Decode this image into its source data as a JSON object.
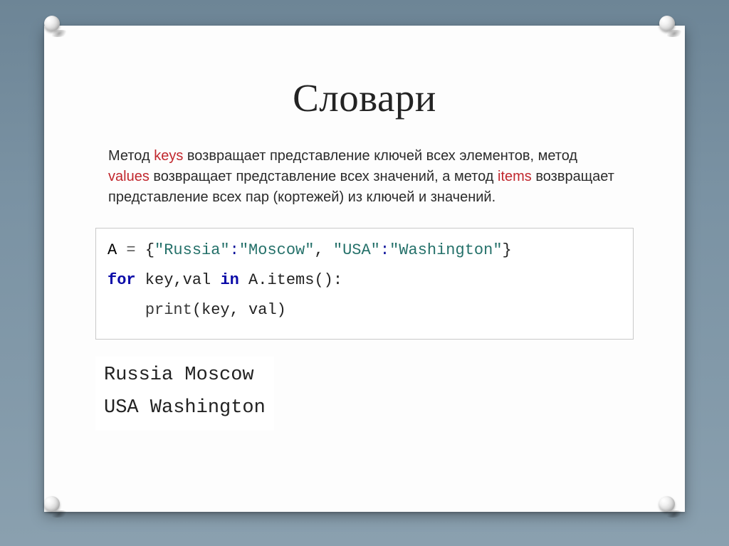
{
  "slide": {
    "title": "Словари",
    "description": {
      "p1a": "Метод ",
      "k1": "keys",
      "p1b": " возвращает представление ключей всех элементов, метод ",
      "k2": "values",
      "p1c": " возвращает представление всех значений, а метод ",
      "k3": "items",
      "p1d": " возвращает представление всех пар (кортежей) из ключей и значений."
    },
    "code": {
      "l1_var": "A",
      "l1_eq": " = ",
      "l1_b1": "{",
      "l1_k1": "\"Russia\"",
      "l1_c1": ":",
      "l1_v1": "\"Moscow\"",
      "l1_cm": ", ",
      "l1_k2": "\"USA\"",
      "l1_c2": ":",
      "l1_v2": "\"Washington\"",
      "l1_b2": "}",
      "l2_for": "for",
      "l2_vars": " key,val ",
      "l2_in": "in",
      "l2_call": " A.items():",
      "l3_indent": "    ",
      "l3_fn": "print",
      "l3_args": "(key, val)"
    },
    "output": {
      "l1": "Russia Moscow",
      "l2": "USA Washington"
    }
  }
}
